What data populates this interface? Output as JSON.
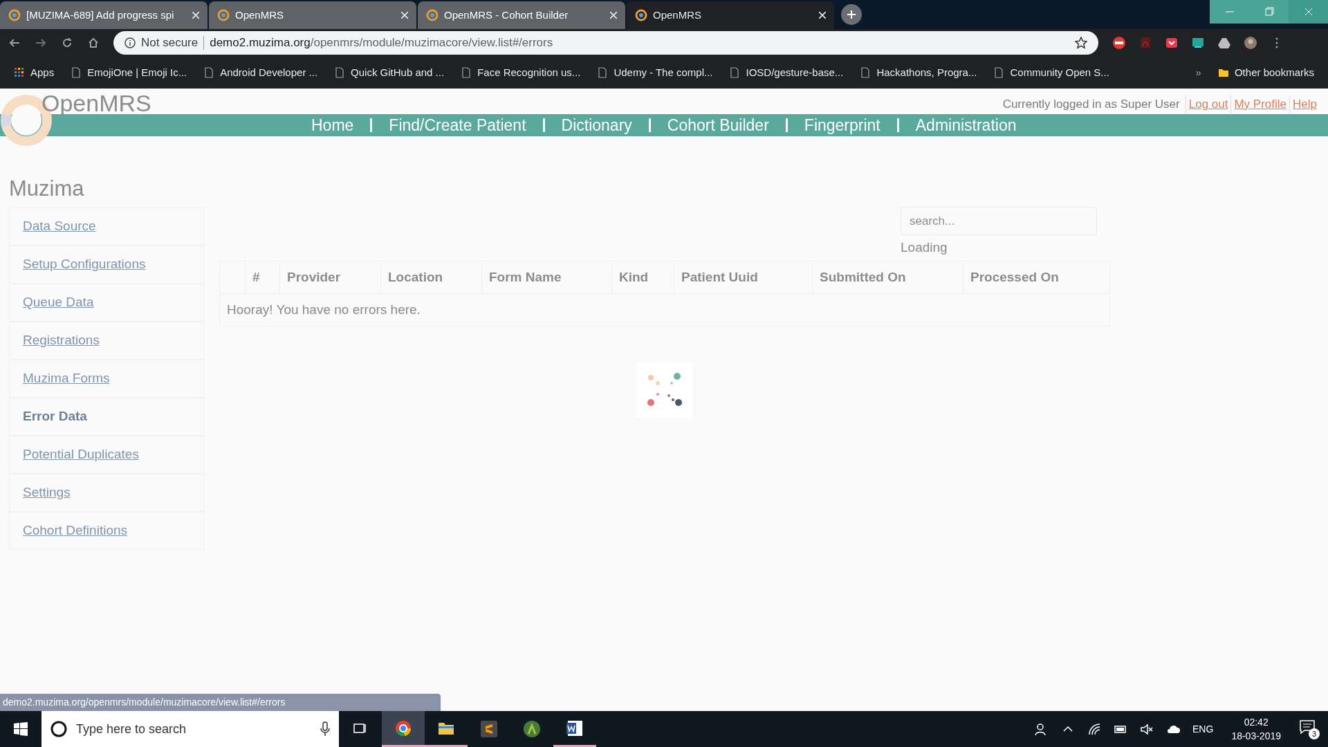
{
  "browser": {
    "tabs": [
      {
        "title": "[MUZIMA-689] Add progress spi",
        "selected": false
      },
      {
        "title": "OpenMRS",
        "selected": false
      },
      {
        "title": "OpenMRS - Cohort Builder",
        "selected": false
      },
      {
        "title": "OpenMRS",
        "selected": true
      }
    ],
    "security_label": "Not secure",
    "url_host": "demo2.muzima.org",
    "url_path": "/openmrs/module/muzimacore/view.list#/errors",
    "bookmarks": [
      "Apps",
      "EmojiOne | Emoji Ic...",
      "Android Developer ...",
      "Quick GitHub and ...",
      "Face Recognition us...",
      "Udemy - The compl...",
      "IOSD/gesture-base...",
      "Hackathons, Progra...",
      "Community Open S..."
    ],
    "overflow": "»",
    "other_bookmarks": "Other bookmarks",
    "status_url": "demo2.muzima.org/openmrs/module/muzimacore/view.list#/errors"
  },
  "page": {
    "logo": "OpenMRS",
    "user_info": "Currently logged in as Super User",
    "user_links": [
      "Log out",
      "My Profile",
      "Help"
    ],
    "nav": [
      "Home",
      "Find/Create Patient",
      "Dictionary",
      "Cohort Builder",
      "Fingerprint",
      "Administration"
    ],
    "sidebar": {
      "title": "Muzima",
      "items": [
        {
          "label": "Data Source",
          "selected": false
        },
        {
          "label": "Setup Configurations",
          "selected": false
        },
        {
          "label": "Queue Data",
          "selected": false
        },
        {
          "label": "Registrations",
          "selected": false
        },
        {
          "label": "Muzima Forms",
          "selected": false
        },
        {
          "label": "Error Data",
          "selected": true
        },
        {
          "label": "Potential Duplicates",
          "selected": false
        },
        {
          "label": "Settings",
          "selected": false
        },
        {
          "label": "Cohort Definitions",
          "selected": false
        }
      ]
    },
    "search": {
      "placeholder": "search..."
    },
    "loading": "Loading",
    "table": {
      "columns": [
        "#",
        "Provider",
        "Location",
        "Form Name",
        "Kind",
        "Patient Uuid",
        "Submitted On",
        "Processed On"
      ],
      "empty_message": "Hooray! You have no errors here."
    }
  },
  "taskbar": {
    "search_placeholder": "Type here to search",
    "language": "ENG",
    "time": "02:42",
    "date": "18-03-2019",
    "notifications": "3"
  }
}
